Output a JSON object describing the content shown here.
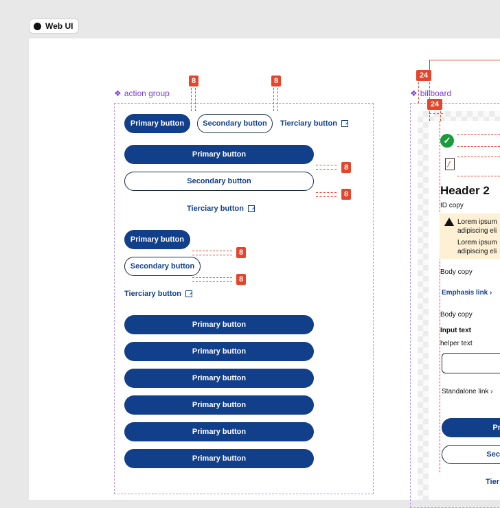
{
  "app": {
    "title": "Web UI"
  },
  "action_group": {
    "label": "action group",
    "inline_row": {
      "primary": "Primary button",
      "secondary": "Secondary button",
      "tierciary": "Tierciary button"
    },
    "stacked_full": {
      "primary": "Primary button",
      "secondary": "Secondary button",
      "tierciary": "Tierciary button"
    },
    "stacked_compact": {
      "primary": "Primary button",
      "secondary": "Secondary button",
      "tierciary": "Tierciary button"
    },
    "primary_list": [
      "Primary button",
      "Primary button",
      "Primary button",
      "Primary button",
      "Primary button",
      "Primary button"
    ],
    "spacing_badges": [
      "8",
      "8",
      "8",
      "8",
      "8",
      "8"
    ]
  },
  "billboard": {
    "label": "billboard",
    "spacing_badges": [
      "24",
      "24"
    ],
    "header": "Header 2",
    "id_copy": "ID copy",
    "alert_lines": [
      "Lorem ipsum",
      "adipiscing eli",
      "Lorem ipsum",
      "adipiscing eli"
    ],
    "body_copy_1": "Body copy",
    "emphasis_link": "Emphasis link",
    "body_copy_2": "Body copy",
    "input_label": "Input text",
    "helper_text": "helper text",
    "standalone_link": "Standalone link",
    "primary_partial": "Pr",
    "secondary_partial": "Sec",
    "tierciary_partial": "Tier"
  },
  "colors": {
    "primary": "#123f8a",
    "redline": "#e5452b",
    "frame": "#b895ee",
    "alert_bg": "#fdf0d5",
    "success": "#1a9c3e"
  }
}
